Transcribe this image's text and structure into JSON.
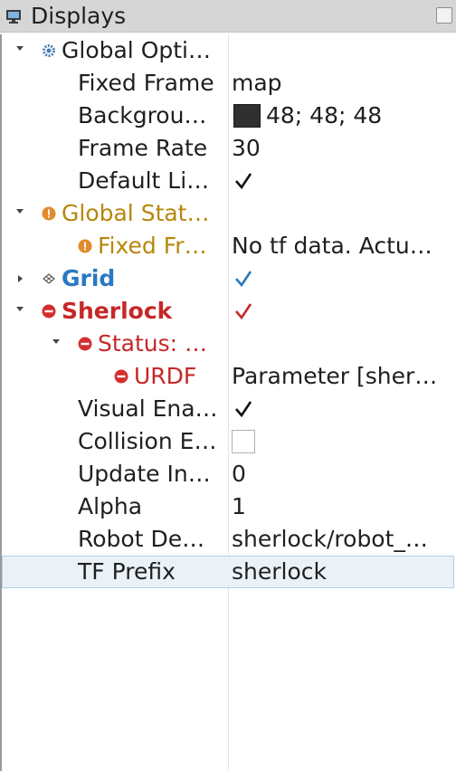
{
  "panel": {
    "title": "Displays"
  },
  "rows": [
    {
      "name": "Global Opti…"
    },
    {
      "name": "Fixed Frame",
      "value": "map"
    },
    {
      "name": "Backgrou…",
      "value": "48; 48; 48",
      "color": "#303030"
    },
    {
      "name": "Frame Rate",
      "value": "30"
    },
    {
      "name": "Default Li…",
      "checked": true
    },
    {
      "name": "Global Stat…"
    },
    {
      "name": "Fixed Fr…",
      "value": "No tf data.  Actu…"
    },
    {
      "name": "Grid",
      "checked": true
    },
    {
      "name": "Sherlock",
      "checked": true
    },
    {
      "name": "Status: …"
    },
    {
      "name": "URDF",
      "value": "Parameter [sher…"
    },
    {
      "name": "Visual Ena…",
      "checked": true
    },
    {
      "name": "Collision E…",
      "checked": false
    },
    {
      "name": "Update In…",
      "value": "0"
    },
    {
      "name": "Alpha",
      "value": "1"
    },
    {
      "name": "Robot De…",
      "value": "sherlock/robot_…"
    },
    {
      "name": "TF Prefix",
      "value": "sherlock",
      "selected": true
    }
  ],
  "icons": {
    "title": "monitor-icon",
    "global_options": "gear-icon",
    "global_status": "warning-icon",
    "fixed_frame_status": "warning-icon",
    "grid": "grid-icon",
    "sherlock": "error-icon",
    "status": "error-icon",
    "urdf": "error-icon"
  },
  "colors": {
    "warning": "#b8860b",
    "error": "#c62828",
    "link_blue": "#2a78c1",
    "selected_row": "#eaf2f8"
  }
}
